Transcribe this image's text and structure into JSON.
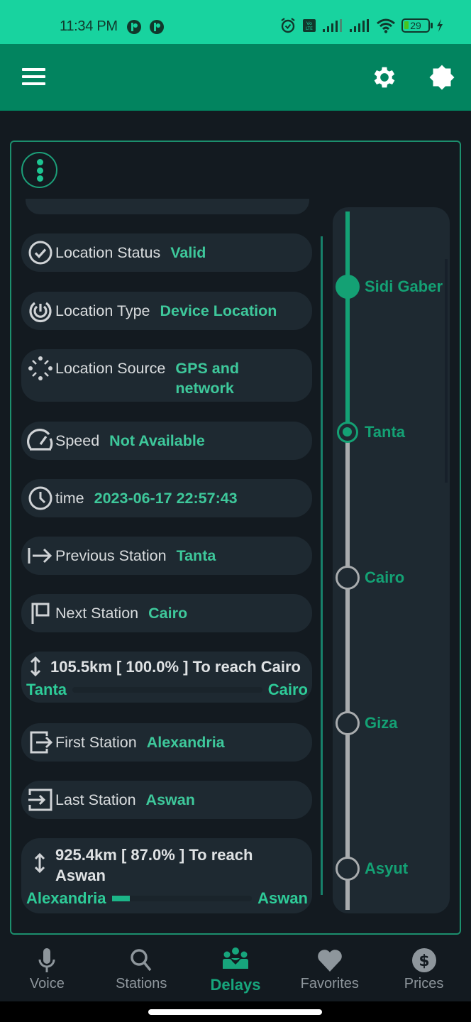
{
  "status_bar": {
    "time": "11:34 PM",
    "battery_level": "29",
    "icons": [
      "app-notification-icon",
      "app-notification-icon",
      "alarm-icon",
      "volte-icon",
      "signal-icon",
      "signal-icon",
      "wifi-icon",
      "battery-icon",
      "charging-icon"
    ]
  },
  "app_bar": {
    "menu_icon": "hamburger-menu-icon",
    "actions": [
      "settings-gear-icon",
      "brightness-theme-icon"
    ]
  },
  "details": {
    "rows": [
      {
        "icon": "check-circle-icon",
        "label": "Location Status",
        "value": "Valid"
      },
      {
        "icon": "location-target-icon",
        "label": "Location Type",
        "value": "Device Location"
      },
      {
        "icon": "dotted-sparkle-icon",
        "label": "Location Source",
        "value": "GPS and network"
      },
      {
        "icon": "speedometer-icon",
        "label": "Speed",
        "value": "Not Available"
      },
      {
        "icon": "clock-icon",
        "label": "time",
        "value": "2023-06-17 22:57:43"
      },
      {
        "icon": "arrow-right-from-bar-icon",
        "label": "Previous Station",
        "value": "Tanta"
      },
      {
        "icon": "flag-icon",
        "label": "Next Station",
        "value": "Cairo"
      }
    ],
    "next_distance": {
      "title": "105.5km [ 100.0% ] To reach Cairo",
      "from": "Tanta",
      "to": "Cairo",
      "progress_percent": 100.0
    },
    "rows2": [
      {
        "icon": "exit-box-icon",
        "label": "First Station",
        "value": "Alexandria"
      },
      {
        "icon": "enter-box-icon",
        "label": "Last Station",
        "value": "Aswan"
      }
    ],
    "total_distance": {
      "title": "925.4km [ 87.0% ] To reach Aswan",
      "from": "Alexandria",
      "to": "Aswan",
      "progress_percent": 87.0
    }
  },
  "timeline": {
    "stations": [
      {
        "name": "Sidi Gaber",
        "state": "passed"
      },
      {
        "name": "Tanta",
        "state": "current"
      },
      {
        "name": "Cairo",
        "state": "upcoming"
      },
      {
        "name": "Giza",
        "state": "upcoming"
      },
      {
        "name": "Asyut",
        "state": "upcoming"
      }
    ],
    "colors": {
      "passed": "#14a174",
      "upcoming": "#a9acae",
      "label": "#14a174"
    }
  },
  "bottom_nav": {
    "items": [
      {
        "label": "Voice",
        "icon": "microphone-icon",
        "active": false
      },
      {
        "label": "Stations",
        "icon": "search-icon",
        "active": false
      },
      {
        "label": "Delays",
        "icon": "people-group-icon",
        "active": true
      },
      {
        "label": "Favorites",
        "icon": "heart-icon",
        "active": false
      },
      {
        "label": "Prices",
        "icon": "dollar-circle-icon",
        "active": false
      }
    ]
  },
  "theme": {
    "status_bar": "#18d39f",
    "app_bar": "#02845f",
    "accent": "#2ecb98",
    "background": "#131a20",
    "card": "#1e2931"
  }
}
